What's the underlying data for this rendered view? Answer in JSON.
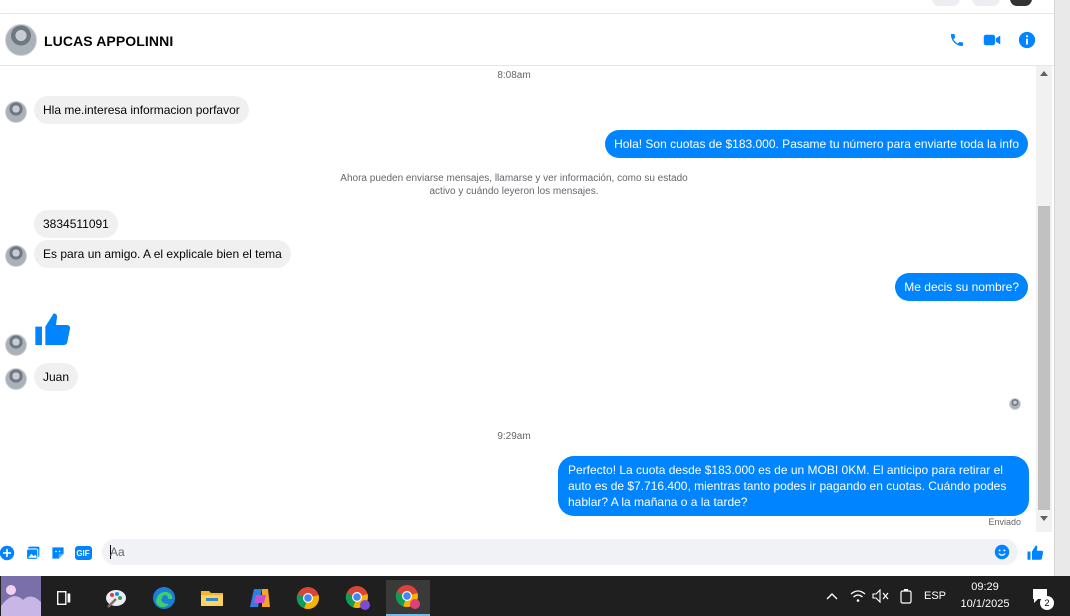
{
  "header": {
    "contact_name": "LUCAS APPOLINNI",
    "icons": [
      "phone-icon",
      "video-icon",
      "info-icon"
    ],
    "accent_color": "#0084ff"
  },
  "chat": {
    "timestamp_1": "8:08am",
    "msg_in_1": "Hla me.interesa informacion porfavor",
    "msg_out_1": "Hola! Son cuotas de $183.000. Pasame tu número para enviarte toda la info",
    "notice_line_1": "Ahora pueden enviarse mensajes, llamarse y ver información, como su estado",
    "notice_line_2": "activo y cuándo leyeron los mensajes.",
    "msg_in_2": "3834511091",
    "msg_in_3": "Es para un amigo.  A el explicale bien el tema",
    "msg_out_2": "Me decis su nombre?",
    "msg_in_4_icon": "thumbs-up-icon",
    "msg_in_5": "Juan",
    "timestamp_2": "9:29am",
    "msg_out_3_line_1": "Perfecto! La cuota desde $183.000 es de un MOBI 0KM. El anticipo para retirar el",
    "msg_out_3_line_2": "auto es de $7.716.400, mientras tanto podes ir pagando en cuotas. Cuándo podes",
    "msg_out_3_line_3": "hablar? A la mañana o a la tarde?",
    "status": "Enviado"
  },
  "composer": {
    "placeholder": "Aa",
    "value": "",
    "icons": [
      "plus-icon",
      "photo-icon",
      "sticker-icon",
      "gif-icon",
      "emoji-icon",
      "like-icon"
    ],
    "gif_label": "GIF"
  },
  "taskbar": {
    "apps": [
      "start-icon",
      "task-view-icon",
      "paint-icon",
      "edge-icon",
      "file-explorer-icon",
      "copilot-icon",
      "chrome-icon",
      "chrome-profile-icon",
      "chrome-profile-active-icon"
    ],
    "language": "ESP",
    "time": "09:29",
    "date": "10/1/2025",
    "notification_count": "2"
  }
}
